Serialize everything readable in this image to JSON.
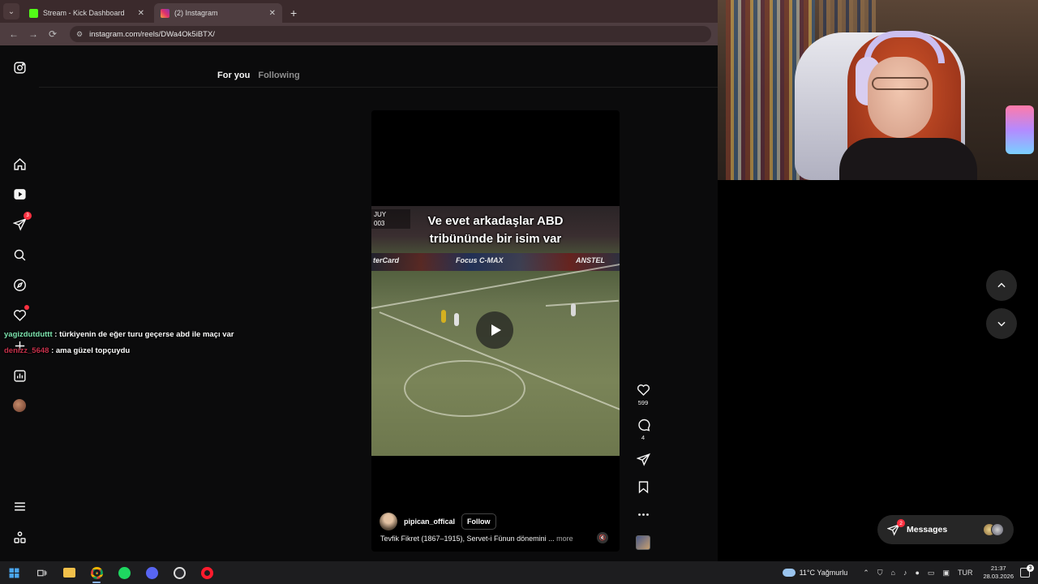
{
  "browser": {
    "tabs": [
      {
        "label": "Stream - Kick Dashboard",
        "favicon_color": "#53fc18"
      },
      {
        "label": "(2) Instagram",
        "favicon_color": "#e1306c"
      }
    ],
    "close_glyph": "✕",
    "new_tab_glyph": "+",
    "tab_menu_glyph": "⌄",
    "url": "instagram.com/reels/DWa4Ok5iBTX/",
    "nav": {
      "back": "←",
      "forward": "→",
      "reload": "⟳"
    }
  },
  "instagram": {
    "nav_icons": [
      "instagram-logo-icon",
      "home-icon",
      "reels-icon",
      "messages-icon",
      "search-icon",
      "explore-icon",
      "notifications-icon",
      "create-icon",
      "dashboard-icon",
      "profile-avatar",
      "menu-icon",
      "meta-apps-icon"
    ],
    "messages_badge": "3",
    "feed_tabs": {
      "for_you": "For you",
      "following": "Following"
    },
    "reel": {
      "caption_line1": "Ve evet arkadaşlar ABD",
      "caption_line2": "tribününde bir isim var",
      "score_line1": "JUY",
      "score_line2": "003",
      "banner_left": "terCard",
      "banner_mid": "Focus C-MAX",
      "banner_right": "ANSTEL",
      "username": "pipican_offical",
      "follow_label": "Follow",
      "description": "Tevfik Fikret (1867–1915), Servet-i Fünun dönemini ...",
      "more_label": "more",
      "likes": "599",
      "comments": "4"
    },
    "messages_button": {
      "label": "Messages",
      "badge": "2"
    }
  },
  "chat": [
    {
      "user": "yagizdutduttt",
      "message": ": türkiyenin de eğer turu geçerse abd ile maçı var"
    },
    {
      "user": "denizz_5648",
      "message": ": ama güzel topçuydu"
    }
  ],
  "taskbar": {
    "weather": "11°C  Yağmurlu",
    "lang": "TUR",
    "time": "21:37",
    "date": "28.03.2026",
    "notif_count": "3"
  },
  "colors": {
    "accent_red": "#ff3040",
    "ig_bg": "#0b0b0c",
    "chrome_tab": "#3b2a2c"
  }
}
